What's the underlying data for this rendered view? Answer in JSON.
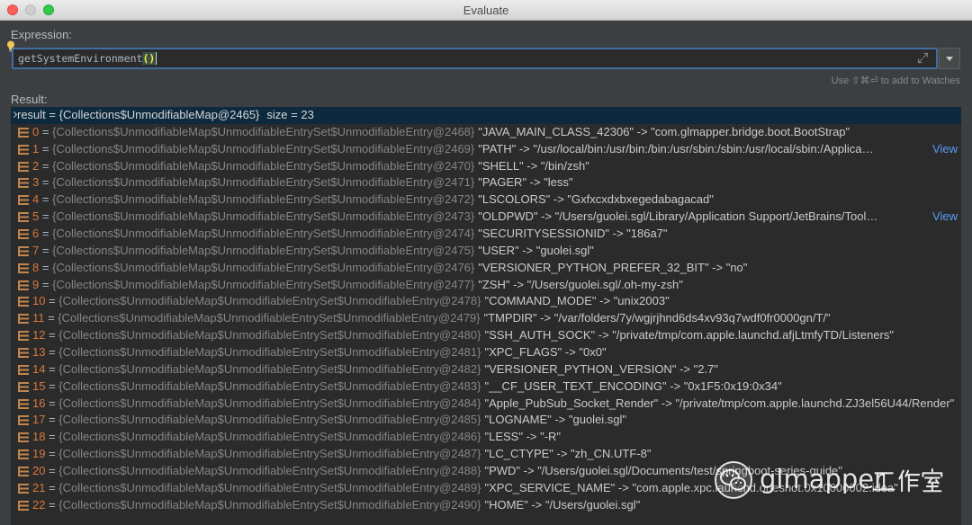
{
  "window": {
    "title": "Evaluate"
  },
  "expression": {
    "label": "Expression:",
    "call": "getSystemEnvironment",
    "parens": "()",
    "hint": "Use ⇧⌘⏎ to add to Watches"
  },
  "result": {
    "label": "Result:",
    "equals": " = ",
    "root": {
      "name": "result",
      "type": "{Collections$UnmodifiableMap@2465}",
      "extra": "size = 23"
    },
    "rows": [
      {
        "index": "0",
        "type": "{Collections$UnmodifiableMap$UnmodifiableEntrySet$UnmodifiableEntry@2468}",
        "value": "\"JAVA_MAIN_CLASS_42306\" -> \"com.glmapper.bridge.boot.BootStrap\""
      },
      {
        "index": "1",
        "type": "{Collections$UnmodifiableMap$UnmodifiableEntrySet$UnmodifiableEntry@2469}",
        "value": "\"PATH\" -> \"/usr/local/bin:/usr/bin:/bin:/usr/sbin:/sbin:/usr/local/sbin:/Applica…",
        "link": "View"
      },
      {
        "index": "2",
        "type": "{Collections$UnmodifiableMap$UnmodifiableEntrySet$UnmodifiableEntry@2470}",
        "value": "\"SHELL\" -> \"/bin/zsh\""
      },
      {
        "index": "3",
        "type": "{Collections$UnmodifiableMap$UnmodifiableEntrySet$UnmodifiableEntry@2471}",
        "value": "\"PAGER\" -> \"less\""
      },
      {
        "index": "4",
        "type": "{Collections$UnmodifiableMap$UnmodifiableEntrySet$UnmodifiableEntry@2472}",
        "value": "\"LSCOLORS\" -> \"Gxfxcxdxbxegedabagacad\""
      },
      {
        "index": "5",
        "type": "{Collections$UnmodifiableMap$UnmodifiableEntrySet$UnmodifiableEntry@2473}",
        "value": "\"OLDPWD\" -> \"/Users/guolei.sgl/Library/Application Support/JetBrains/Tool…",
        "link": "View"
      },
      {
        "index": "6",
        "type": "{Collections$UnmodifiableMap$UnmodifiableEntrySet$UnmodifiableEntry@2474}",
        "value": "\"SECURITYSESSIONID\" -> \"186a7\""
      },
      {
        "index": "7",
        "type": "{Collections$UnmodifiableMap$UnmodifiableEntrySet$UnmodifiableEntry@2475}",
        "value": "\"USER\" -> \"guolei.sgl\""
      },
      {
        "index": "8",
        "type": "{Collections$UnmodifiableMap$UnmodifiableEntrySet$UnmodifiableEntry@2476}",
        "value": "\"VERSIONER_PYTHON_PREFER_32_BIT\" -> \"no\""
      },
      {
        "index": "9",
        "type": "{Collections$UnmodifiableMap$UnmodifiableEntrySet$UnmodifiableEntry@2477}",
        "value": "\"ZSH\" -> \"/Users/guolei.sgl/.oh-my-zsh\""
      },
      {
        "index": "10",
        "type": "{Collections$UnmodifiableMap$UnmodifiableEntrySet$UnmodifiableEntry@2478}",
        "value": "\"COMMAND_MODE\" -> \"unix2003\""
      },
      {
        "index": "11",
        "type": "{Collections$UnmodifiableMap$UnmodifiableEntrySet$UnmodifiableEntry@2479}",
        "value": "\"TMPDIR\" -> \"/var/folders/7y/wgjrjhnd6ds4xv93q7wdf0fr0000gn/T/\""
      },
      {
        "index": "12",
        "type": "{Collections$UnmodifiableMap$UnmodifiableEntrySet$UnmodifiableEntry@2480}",
        "value": "\"SSH_AUTH_SOCK\" -> \"/private/tmp/com.apple.launchd.afjLtmfyTD/Listeners\""
      },
      {
        "index": "13",
        "type": "{Collections$UnmodifiableMap$UnmodifiableEntrySet$UnmodifiableEntry@2481}",
        "value": "\"XPC_FLAGS\" -> \"0x0\""
      },
      {
        "index": "14",
        "type": "{Collections$UnmodifiableMap$UnmodifiableEntrySet$UnmodifiableEntry@2482}",
        "value": "\"VERSIONER_PYTHON_VERSION\" -> \"2.7\""
      },
      {
        "index": "15",
        "type": "{Collections$UnmodifiableMap$UnmodifiableEntrySet$UnmodifiableEntry@2483}",
        "value": "\"__CF_USER_TEXT_ENCODING\" -> \"0x1F5:0x19:0x34\""
      },
      {
        "index": "16",
        "type": "{Collections$UnmodifiableMap$UnmodifiableEntrySet$UnmodifiableEntry@2484}",
        "value": "\"Apple_PubSub_Socket_Render\" -> \"/private/tmp/com.apple.launchd.ZJ3el56U44/Render\""
      },
      {
        "index": "17",
        "type": "{Collections$UnmodifiableMap$UnmodifiableEntrySet$UnmodifiableEntry@2485}",
        "value": "\"LOGNAME\" -> \"guolei.sgl\""
      },
      {
        "index": "18",
        "type": "{Collections$UnmodifiableMap$UnmodifiableEntrySet$UnmodifiableEntry@2486}",
        "value": "\"LESS\" -> \"-R\""
      },
      {
        "index": "19",
        "type": "{Collections$UnmodifiableMap$UnmodifiableEntrySet$UnmodifiableEntry@2487}",
        "value": "\"LC_CTYPE\" -> \"zh_CN.UTF-8\""
      },
      {
        "index": "20",
        "type": "{Collections$UnmodifiableMap$UnmodifiableEntrySet$UnmodifiableEntry@2488}",
        "value": "\"PWD\" -> \"/Users/guolei.sgl/Documents/test/springboot-series-guide\""
      },
      {
        "index": "21",
        "type": "{Collections$UnmodifiableMap$UnmodifiableEntrySet$UnmodifiableEntry@2489}",
        "value": "\"XPC_SERVICE_NAME\" -> \"com.apple.xpc.launchd.oneshot.0x10000002.idea\""
      },
      {
        "index": "22",
        "type": "{Collections$UnmodifiableMap$UnmodifiableEntrySet$UnmodifiableEntry@2490}",
        "value": "\"HOME\" -> \"/Users/guolei.sgl\""
      }
    ]
  },
  "watermark": {
    "brand": "glmapper",
    "suffix": "工作室",
    "icon": "wechat-icon"
  },
  "colors": {
    "selection": "#0d293e",
    "index": "#d9793d",
    "link": "#589df6",
    "focus_ring": "#3f6e9f",
    "brace_match": "#ffef28"
  }
}
